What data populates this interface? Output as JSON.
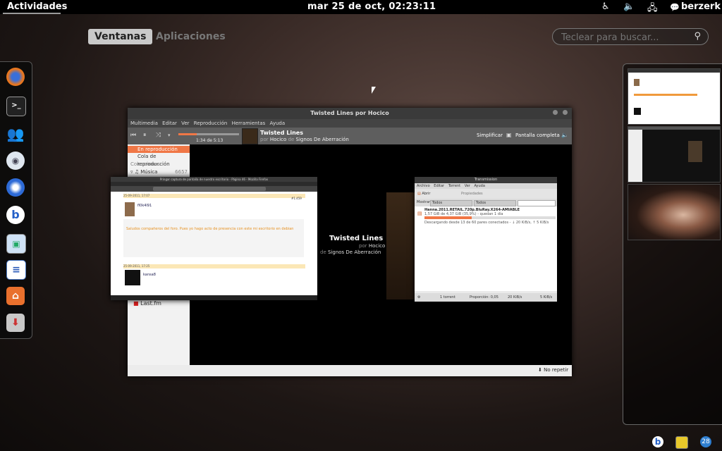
{
  "topbar": {
    "activities": "Actividades",
    "clock": "mar 25 de oct, 02:23:11",
    "user": "berzerk"
  },
  "overview": {
    "tab_windows": "Ventanas",
    "tab_apps": "Aplicaciones",
    "search_placeholder": "Teclear para buscar..."
  },
  "dock_icons": [
    "firefox-icon",
    "terminal-icon",
    "empathy-icon",
    "pidgin-icon",
    "thunderbird-icon",
    "banshee-icon",
    "shotwell-icon",
    "libreoffice-writer-icon",
    "files-icon",
    "software-center-icon"
  ],
  "rhythmbox": {
    "title": "Twisted Lines por Hocico",
    "menus": [
      "Multimedia",
      "Editar",
      "Ver",
      "Reproducción",
      "Herramientas",
      "Ayuda"
    ],
    "track": "Twisted Lines",
    "by_prefix": "por",
    "artist": "Hocico",
    "from_prefix": "de",
    "album": "Signos De Aberración",
    "time": "1:34 de 5:13",
    "simplify": "Simplificar",
    "fullscreen": "Pantalla completa",
    "sidebar": [
      "En reproducción",
      "Cola de reproducción",
      "Colecciones",
      "Música"
    ],
    "music_count": "6657",
    "lastfm": "Last.fm",
    "repeat": "No repetir",
    "progress": 0.3
  },
  "chat": {
    "title": "Pringar captura de pantalla de nuestro escritorio - Página 46 - Mozilla Firefox",
    "user1": "fl0k4l91",
    "post_date": "25-09-2011, 17:07",
    "post_text": "Saludos compañeros del foro. Pues yo hago acto de presencia con este mi escritorio en debian",
    "user2": "kansa8",
    "post2_date": "25-09-2011, 17:25",
    "post_id": "#1.459"
  },
  "transmission": {
    "title": "Transmission",
    "menus": [
      "Archivo",
      "Editar",
      "Torrent",
      "Ver",
      "Ayuda"
    ],
    "open": "Abrir",
    "properties": "Propiedades",
    "show": "Mostrar",
    "filter_all_1": "Todos",
    "filter_all_2": "Todos",
    "torrent_name": "Hanna.2011.RETAIL.720p.BluRay.X264-AMIABLE",
    "torrent_size": "1,57 GiB de 4,37 GiB (35,9%) - quedan 1 día",
    "torrent_status": "Descargando desde 13 de 60 pares conectados - ↓ 20 KiB/s, ↑ 5 KiB/s",
    "torrent_count": "1 torrent",
    "ratio": "Proporción: 0,05",
    "down": "20 KiB/s",
    "up": "5 KiB/s",
    "progress": 0.36
  },
  "tray": {
    "badge": "28"
  },
  "colors": {
    "accent": "#f07746",
    "topbar": "#000000"
  }
}
